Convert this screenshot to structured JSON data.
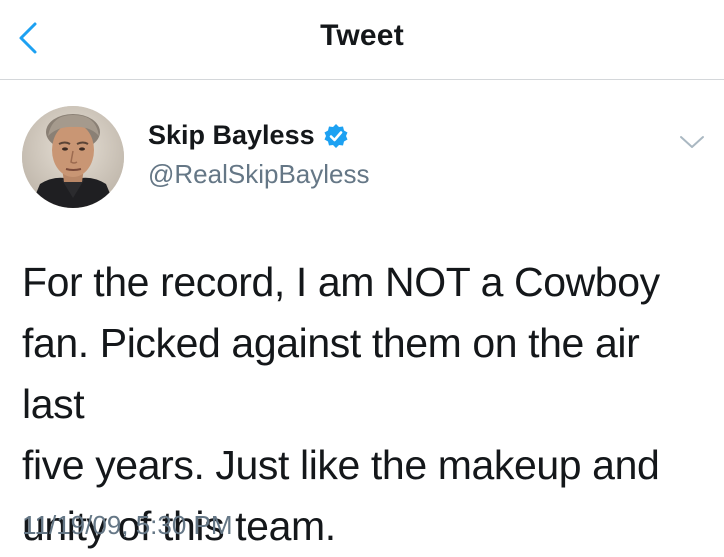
{
  "nav": {
    "title": "Tweet",
    "back_icon": "chevron-left-icon"
  },
  "tweet": {
    "author": {
      "display_name": "Skip Bayless",
      "handle": "@RealSkipBayless",
      "verified": true,
      "avatar_icon": "avatar-photo"
    },
    "menu_icon": "chevron-down-icon",
    "text": "For the record, I am NOT a Cowboy\nfan. Picked against them on the air last\nfive years. Just like the makeup and\nunity of this team.",
    "timestamp": "11/19/09, 5:30 PM"
  },
  "colors": {
    "accent": "#1da1f2",
    "secondary_text": "#657786",
    "primary_text": "#14171a",
    "divider": "#d4d7da"
  }
}
